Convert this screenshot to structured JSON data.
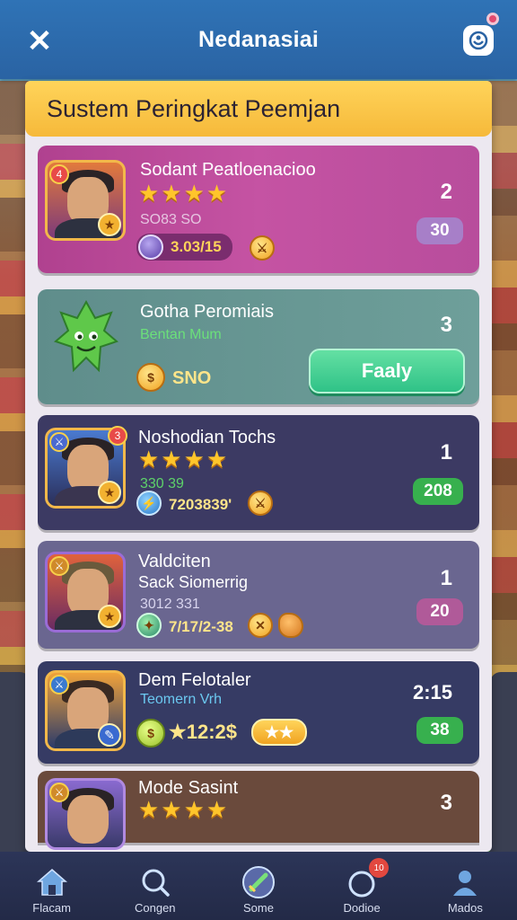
{
  "header": {
    "title": "Nedanasiai",
    "close_icon": "close-icon",
    "profile_icon": "profile-icon"
  },
  "panel": {
    "title": "Sustem Peringkat Peemjan"
  },
  "leaderboard": [
    {
      "name": "Sodant Peatloenacioo",
      "stars": 4,
      "sub_text": "SO83 SO",
      "currency_value": "3.03/15",
      "rank": "2",
      "score": "30",
      "badge": "4",
      "colors": {
        "row": "#c553a3",
        "pill": "#a77fc8"
      }
    },
    {
      "name": "Gotha Peromiais",
      "sub_text": "Bentan Mum",
      "coin_value": "SNO",
      "rank": "3",
      "button_label": "Faaly",
      "colors": {
        "row": "#6e9f9a",
        "button": "#2fc287"
      }
    },
    {
      "name": "Noshodian Tochs",
      "stars": 4,
      "sub_text": "330 39",
      "currency_value": "7203839'",
      "rank": "1",
      "score": "208",
      "badge": "3",
      "colors": {
        "row": "#3c3a63",
        "pill": "#37b04e"
      }
    },
    {
      "name": "Valdciten",
      "sub_name": "Sack Siomerrig",
      "sub_text": "3012 331",
      "currency_value": "7/17/2-38",
      "rank": "1",
      "score": "20",
      "colors": {
        "row": "#6a6690",
        "pill": "#b05a99"
      }
    },
    {
      "name": "Dem Felotaler",
      "sub_text": "Teomern Vrh",
      "currency_value": "★12:2$",
      "rank": "2:15",
      "score": "38",
      "colors": {
        "row": "#363b64",
        "pill": "#37b04e"
      }
    },
    {
      "name": "Mode Sasint",
      "stars": 4,
      "rank": "3",
      "colors": {
        "row": "#6a4a3c"
      }
    }
  ],
  "bottom_nav": [
    {
      "label": "Flacam",
      "icon": "home-icon"
    },
    {
      "label": "Congen",
      "icon": "search-icon"
    },
    {
      "label": "Some",
      "icon": "sword-icon"
    },
    {
      "label": "Dodioe",
      "icon": "notification-icon",
      "badge": "10"
    },
    {
      "label": "Mados",
      "icon": "user-icon"
    }
  ]
}
